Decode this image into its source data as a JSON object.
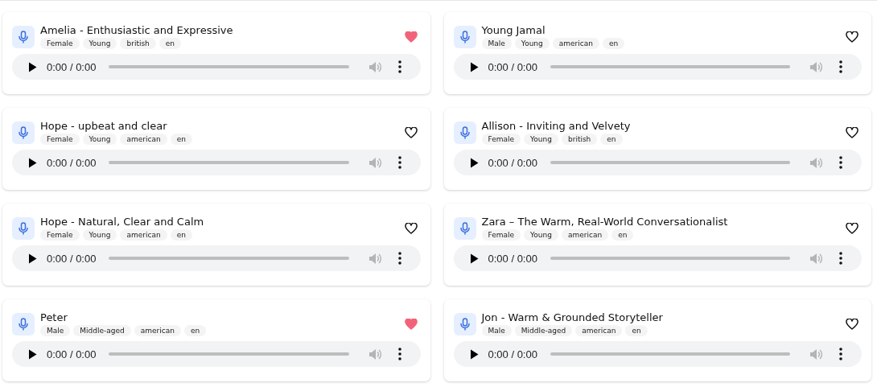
{
  "voices": [
    {
      "name": "Amelia - Enthusiastic and Expressive",
      "tags": [
        "Female",
        "Young",
        "british",
        "en"
      ],
      "favorite": true,
      "time": "0:00 / 0:00"
    },
    {
      "name": "Young Jamal",
      "tags": [
        "Male",
        "Young",
        "american",
        "en"
      ],
      "favorite": false,
      "time": "0:00 / 0:00"
    },
    {
      "name": "Hope - upbeat and clear",
      "tags": [
        "Female",
        "Young",
        "american",
        "en"
      ],
      "favorite": false,
      "time": "0:00 / 0:00"
    },
    {
      "name": "Allison - Inviting and Velvety",
      "tags": [
        "Female",
        "Young",
        "british",
        "en"
      ],
      "favorite": false,
      "time": "0:00 / 0:00"
    },
    {
      "name": "Hope - Natural, Clear and Calm",
      "tags": [
        "Female",
        "Young",
        "american",
        "en"
      ],
      "favorite": false,
      "time": "0:00 / 0:00"
    },
    {
      "name": "Zara – The Warm, Real-World Conversationalist",
      "tags": [
        "Female",
        "Young",
        "american",
        "en"
      ],
      "favorite": false,
      "time": "0:00 / 0:00"
    },
    {
      "name": "Peter",
      "tags": [
        "Male",
        "Middle-aged",
        "american",
        "en"
      ],
      "favorite": true,
      "time": "0:00 / 0:00"
    },
    {
      "name": "Jon - Warm & Grounded Storyteller",
      "tags": [
        "Male",
        "Middle-aged",
        "american",
        "en"
      ],
      "favorite": false,
      "time": "0:00 / 0:00"
    }
  ]
}
